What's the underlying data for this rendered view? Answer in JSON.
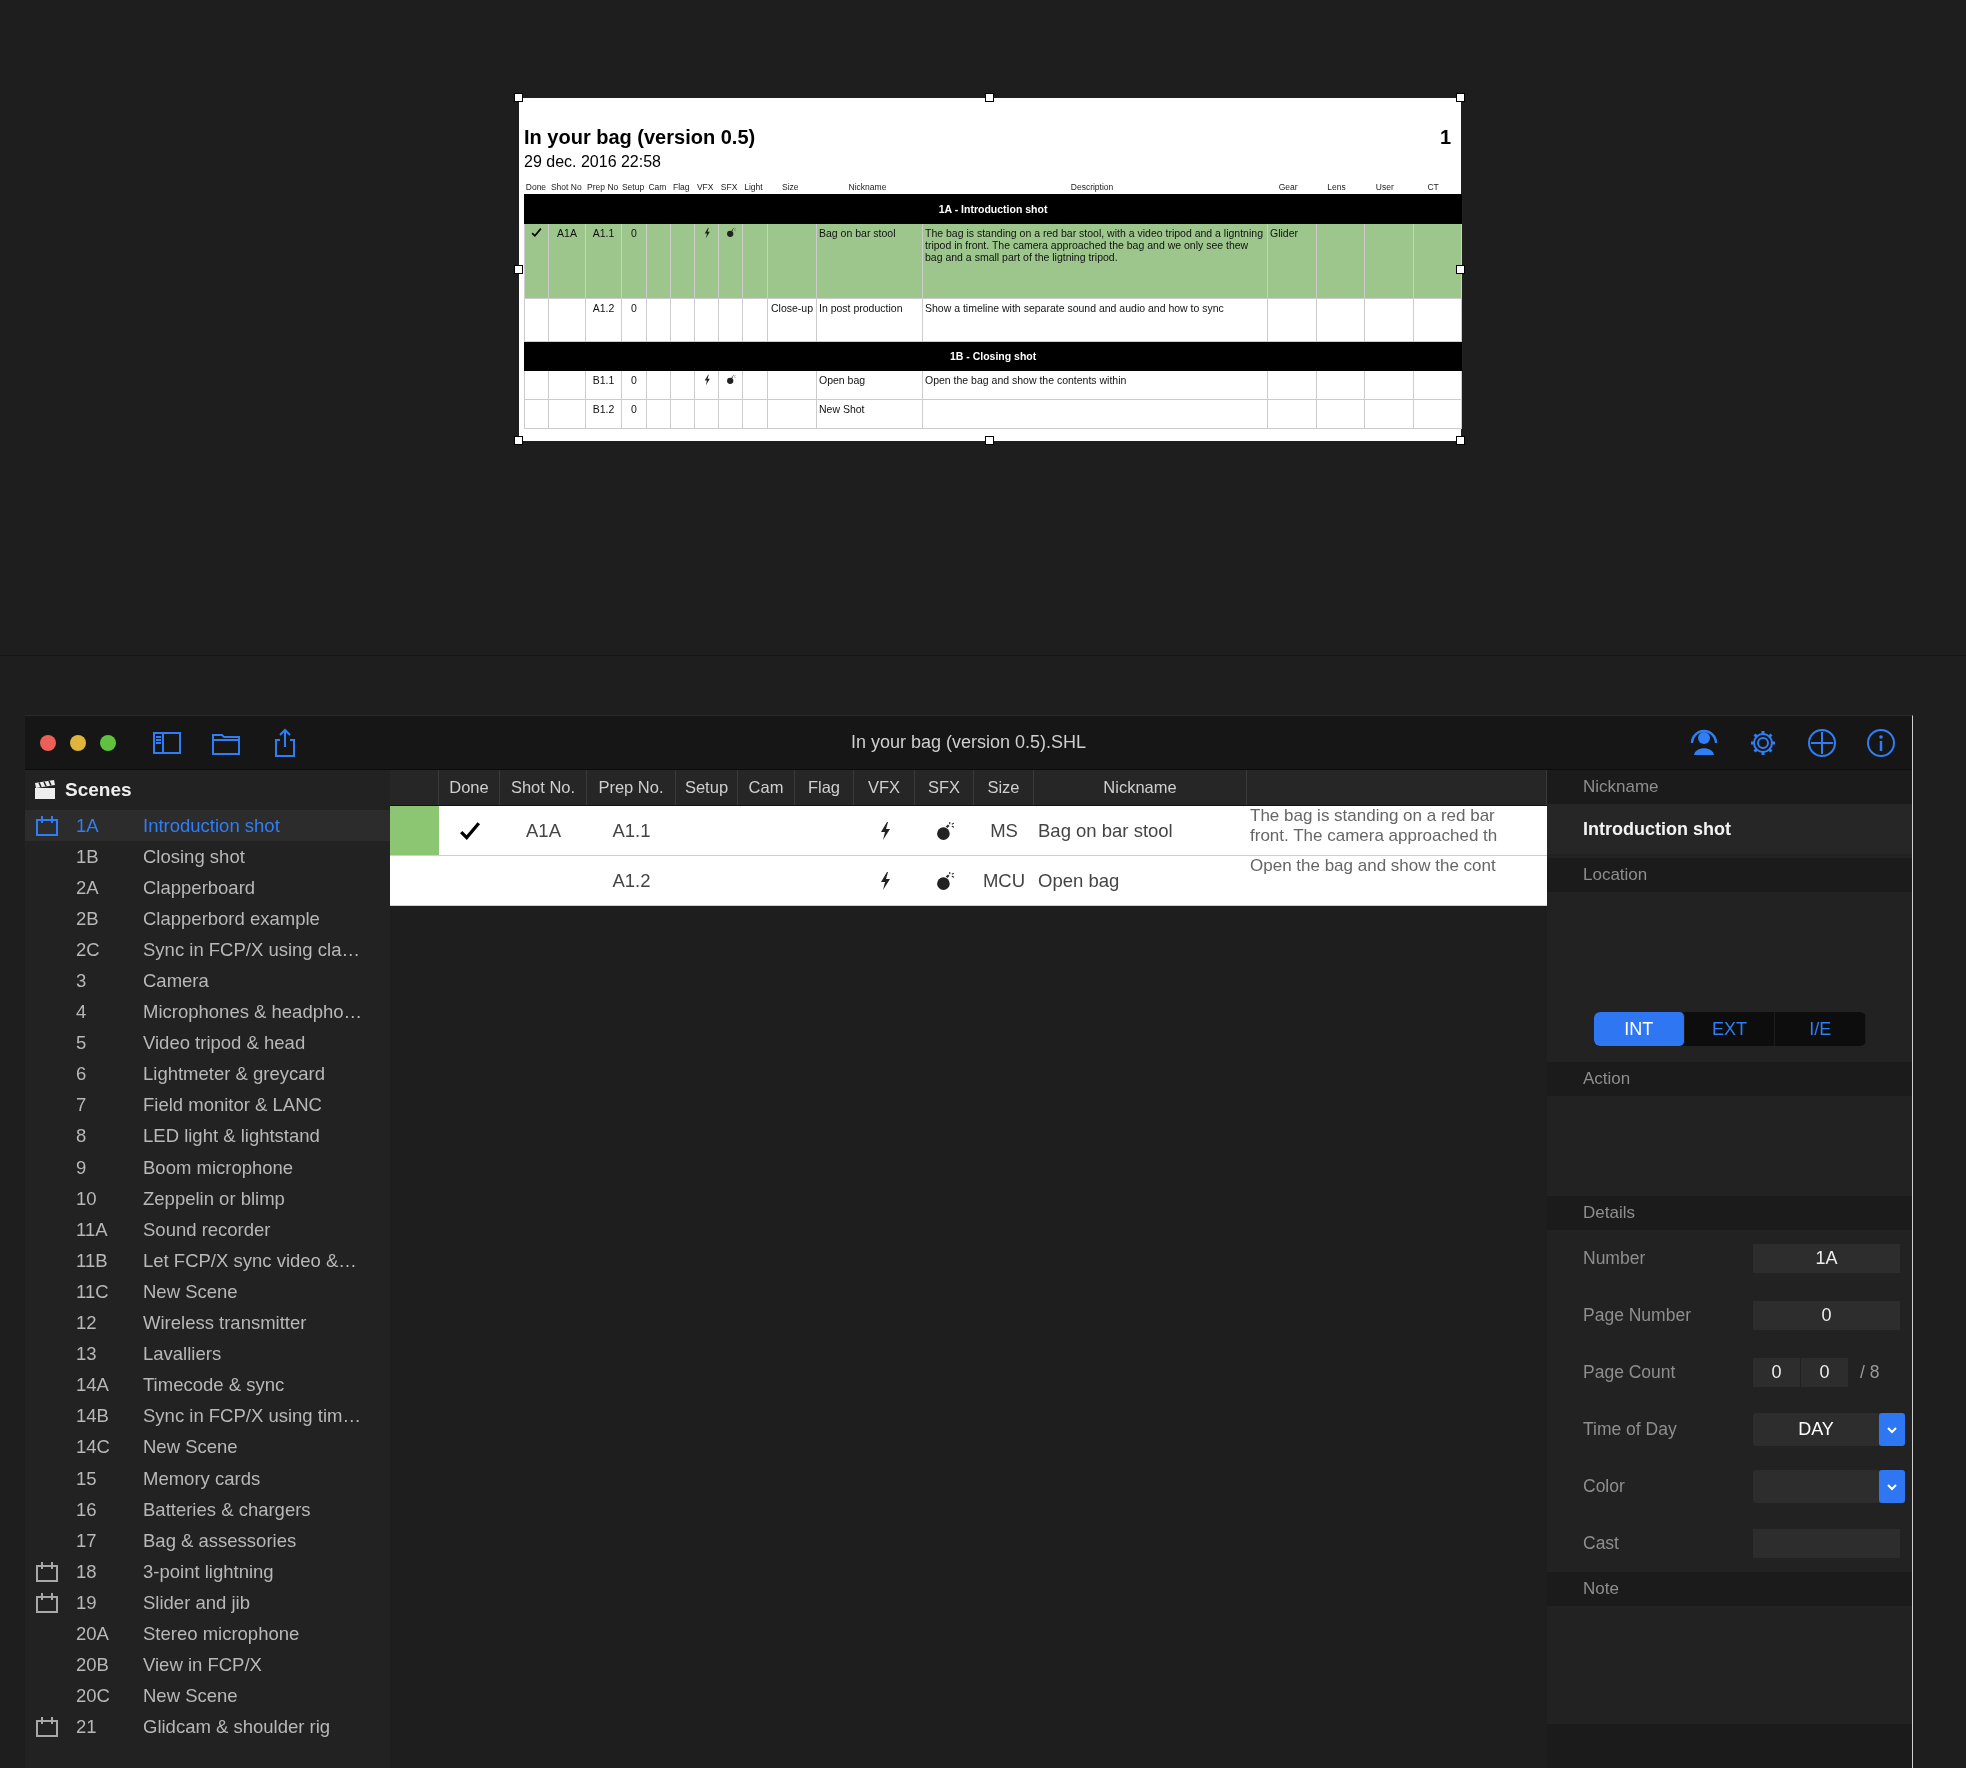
{
  "print_preview": {
    "title": "In your bag (version 0.5)",
    "date": "29 dec. 2016 22:58",
    "page_number": "1",
    "columns": [
      "Done",
      "Shot No",
      "Prep No",
      "Setup",
      "Cam",
      "Flag",
      "VFX",
      "SFX",
      "Light",
      "Size",
      "Nickname",
      "Description",
      "Gear",
      "Lens",
      "User",
      "CT"
    ],
    "groups": [
      {
        "heading": "1A - Introduction shot",
        "rows": [
          {
            "highlighted": true,
            "done": true,
            "shot_no": "A1A",
            "prep_no": "A1.1",
            "setup": "0",
            "vfx": true,
            "sfx": true,
            "nickname": "Bag on bar stool",
            "description": "The bag is standing on a red bar stool, with a video tripod and a ligntning tripod in front. The camera approached the bag and we only see thew bag and a small part of the ligtning tripod.",
            "gear": "Glider"
          },
          {
            "highlighted": false,
            "done": false,
            "prep_no": "A1.2",
            "setup": "0",
            "vfx": false,
            "sfx": false,
            "size": "Close-up",
            "nickname": "In post production",
            "description": "Show a timeline with separate sound and audio and how to sync"
          }
        ]
      },
      {
        "heading": "1B - Closing shot",
        "rows": [
          {
            "highlighted": false,
            "done": false,
            "prep_no": "B1.1",
            "setup": "0",
            "vfx": true,
            "sfx": true,
            "nickname": "Open bag",
            "description": "Open the bag and show the contents within"
          },
          {
            "highlighted": false,
            "done": false,
            "prep_no": "B1.2",
            "setup": "0",
            "vfx": false,
            "sfx": false,
            "nickname": "New Shot"
          }
        ]
      }
    ]
  },
  "app": {
    "window_title": "In your bag (version 0.5).SHL",
    "sidebar": {
      "heading": "Scenes",
      "items": [
        {
          "number": "1A",
          "title": "Introduction shot",
          "selected": true,
          "calendar": true
        },
        {
          "number": "1B",
          "title": "Closing shot",
          "selected": false,
          "calendar": false
        },
        {
          "number": "2A",
          "title": "Clapperboard",
          "selected": false,
          "calendar": false
        },
        {
          "number": "2B",
          "title": "Clapperbord example",
          "selected": false,
          "calendar": false
        },
        {
          "number": "2C",
          "title": "Sync in FCP/X using cla…",
          "selected": false,
          "calendar": false
        },
        {
          "number": "3",
          "title": "Camera",
          "selected": false,
          "calendar": false
        },
        {
          "number": "4",
          "title": "Microphones & headpho…",
          "selected": false,
          "calendar": false
        },
        {
          "number": "5",
          "title": "Video tripod & head",
          "selected": false,
          "calendar": false
        },
        {
          "number": "6",
          "title": "Lightmeter & greycard",
          "selected": false,
          "calendar": false
        },
        {
          "number": "7",
          "title": "Field monitor & LANC",
          "selected": false,
          "calendar": false
        },
        {
          "number": "8",
          "title": "LED light & lightstand",
          "selected": false,
          "calendar": false
        },
        {
          "number": "9",
          "title": "Boom microphone",
          "selected": false,
          "calendar": false
        },
        {
          "number": "10",
          "title": "Zeppelin or blimp",
          "selected": false,
          "calendar": false
        },
        {
          "number": "11A",
          "title": "Sound recorder",
          "selected": false,
          "calendar": false
        },
        {
          "number": "11B",
          "title": "Let FCP/X sync video &…",
          "selected": false,
          "calendar": false
        },
        {
          "number": "11C",
          "title": "New Scene",
          "selected": false,
          "calendar": false
        },
        {
          "number": "12",
          "title": "Wireless transmitter",
          "selected": false,
          "calendar": false
        },
        {
          "number": "13",
          "title": "Lavalliers",
          "selected": false,
          "calendar": false
        },
        {
          "number": "14A",
          "title": "Timecode & sync",
          "selected": false,
          "calendar": false
        },
        {
          "number": "14B",
          "title": "Sync in FCP/X using tim…",
          "selected": false,
          "calendar": false
        },
        {
          "number": "14C",
          "title": "New Scene",
          "selected": false,
          "calendar": false
        },
        {
          "number": "15",
          "title": "Memory cards",
          "selected": false,
          "calendar": false
        },
        {
          "number": "16",
          "title": "Batteries & chargers",
          "selected": false,
          "calendar": false
        },
        {
          "number": "17",
          "title": "Bag & assessories",
          "selected": false,
          "calendar": false
        },
        {
          "number": "18",
          "title": "3-point lightning",
          "selected": false,
          "calendar": true
        },
        {
          "number": "19",
          "title": "Slider and jib",
          "selected": false,
          "calendar": true
        },
        {
          "number": "20A",
          "title": "Stereo microphone",
          "selected": false,
          "calendar": false
        },
        {
          "number": "20B",
          "title": "View in FCP/X",
          "selected": false,
          "calendar": false
        },
        {
          "number": "20C",
          "title": "New Scene",
          "selected": false,
          "calendar": false
        },
        {
          "number": "21",
          "title": "Glidcam & shoulder rig",
          "selected": false,
          "calendar": true
        }
      ]
    },
    "shots_table": {
      "columns": [
        "Done",
        "Shot No.",
        "Prep No.",
        "Setup",
        "Cam",
        "Flag",
        "VFX",
        "SFX",
        "Size",
        "Nickname"
      ],
      "rows": [
        {
          "color": "#8cc672",
          "done": true,
          "shot_no": "A1A",
          "prep_no": "A1.1",
          "vfx": true,
          "sfx": true,
          "size": "MS",
          "nickname": "Bag on bar stool",
          "description_lines": [
            "The bag is standing on a red bar",
            "front. The camera approached th"
          ]
        },
        {
          "done": false,
          "prep_no": "A1.2",
          "vfx": true,
          "sfx": true,
          "size": "MCU",
          "nickname": "Open bag",
          "description_lines": [
            "Open the bag and show the cont"
          ]
        }
      ]
    },
    "inspector": {
      "nickname_label": "Nickname",
      "nickname": "Introduction shot",
      "location_label": "Location",
      "setting_options": [
        {
          "label": "INT",
          "selected": true
        },
        {
          "label": "EXT",
          "selected": false
        },
        {
          "label": "I/E",
          "selected": false
        }
      ],
      "action_label": "Action",
      "details_label": "Details",
      "number_label": "Number",
      "number": "1A",
      "page_number_label": "Page Number",
      "page_number": "0",
      "page_count_label": "Page Count",
      "page_count": [
        "0",
        "0"
      ],
      "page_count_suffix": "/ 8",
      "time_of_day_label": "Time of Day",
      "time_of_day": "DAY",
      "color_label": "Color",
      "cast_label": "Cast",
      "note_label": "Note"
    }
  }
}
